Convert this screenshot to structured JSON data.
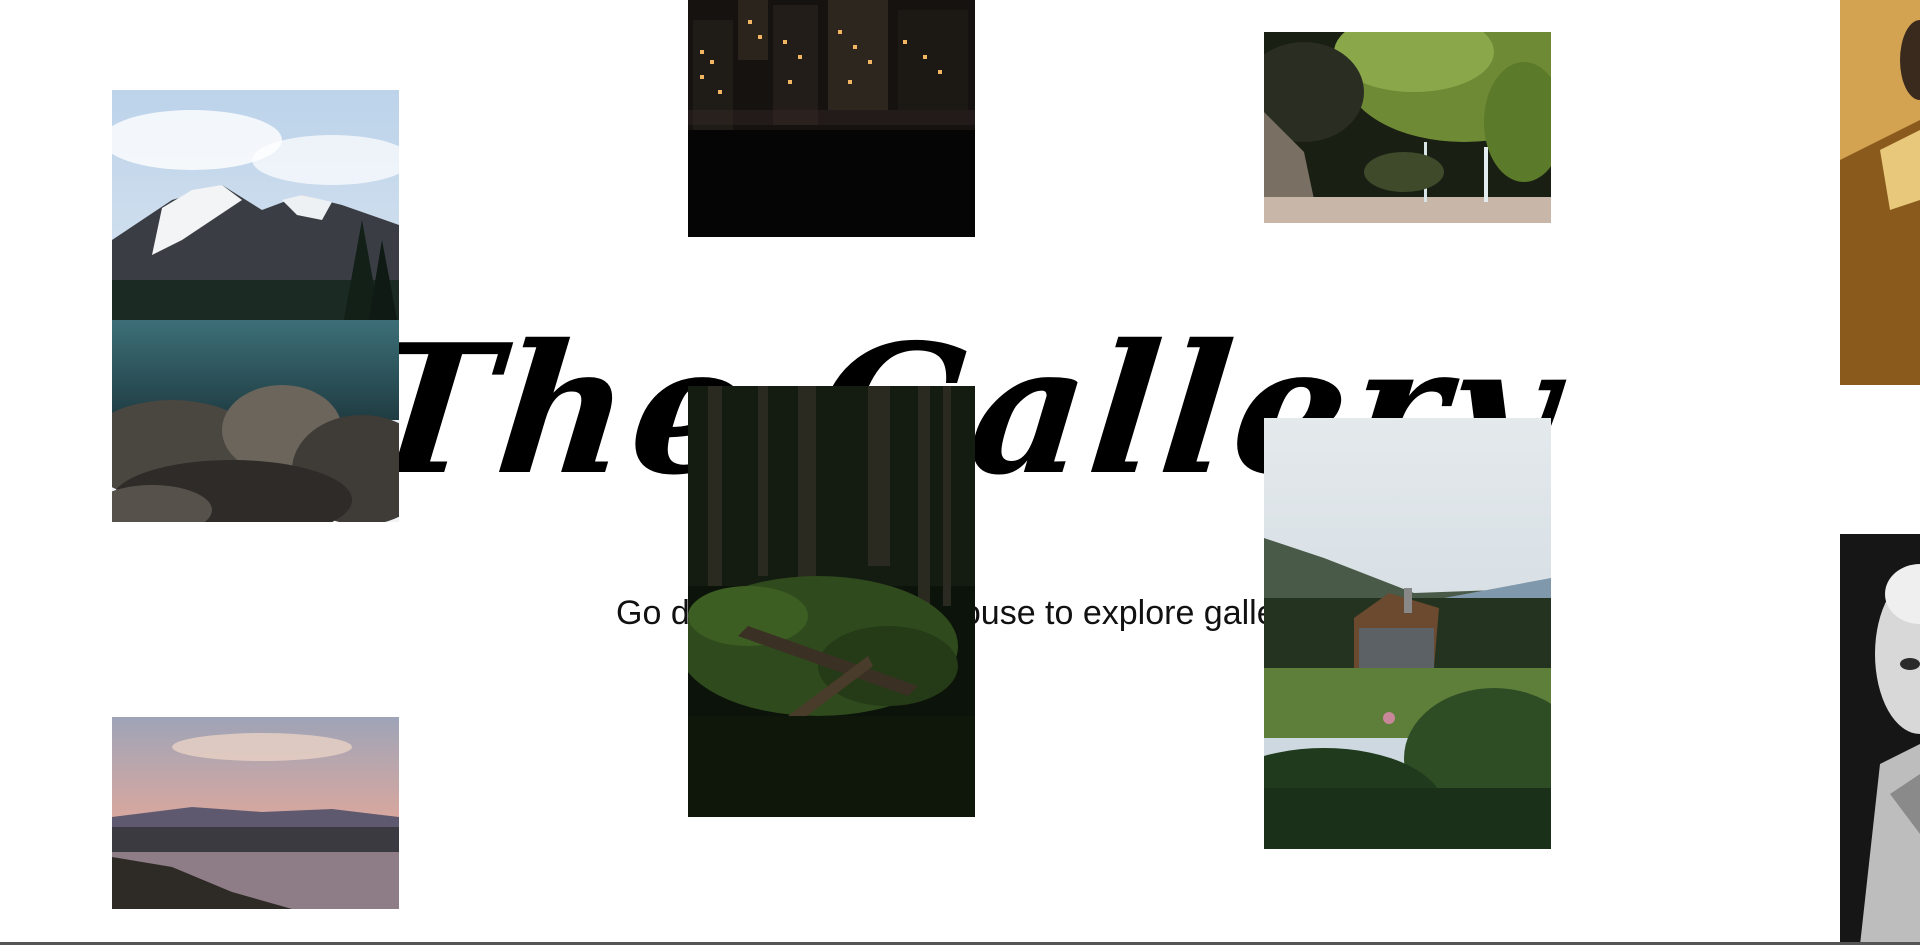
{
  "hero": {
    "title": "The Gallery",
    "subtitle": "Go drag around with mouse to explore gallery"
  },
  "gallery": {
    "tiles": [
      {
        "name": "mountain-lake-photo",
        "subject": "snowy mountain over rocky lake shore"
      },
      {
        "name": "city-night-photo",
        "subject": "city buildings at night over dark water"
      },
      {
        "name": "mossy-cave-waterfall-photo",
        "subject": "moss covered cave with waterfall"
      },
      {
        "name": "portrait-golden-photo",
        "subject": "person in golden light"
      },
      {
        "name": "dark-forest-photo",
        "subject": "forest floor with fallen logs"
      },
      {
        "name": "lodge-house-photo",
        "subject": "wooden lodge by mountains and lawn"
      },
      {
        "name": "sunset-lake-photo",
        "subject": "pink sunset over lake"
      },
      {
        "name": "statue-bw-photo",
        "subject": "black and white statue bust"
      }
    ]
  },
  "colors": {
    "background": "#ffffff",
    "text": "#000000"
  }
}
